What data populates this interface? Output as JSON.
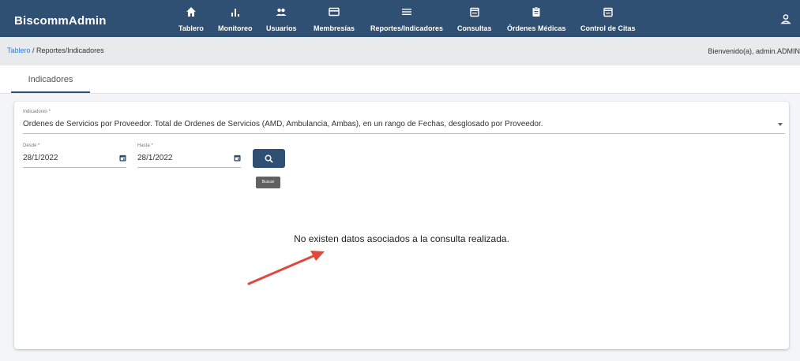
{
  "app": {
    "brand": "BiscommAdmin"
  },
  "nav": {
    "items": [
      {
        "label": "Tablero",
        "icon": "home-icon"
      },
      {
        "label": "Monitoreo",
        "icon": "bar-chart-icon"
      },
      {
        "label": "Usuarios",
        "icon": "users-icon"
      },
      {
        "label": "Membresías",
        "icon": "card-icon"
      },
      {
        "label": "Reportes/Indicadores",
        "icon": "list-icon"
      },
      {
        "label": "Consultas",
        "icon": "calendar-icon"
      },
      {
        "label": "Órdenes Médicas",
        "icon": "clipboard-icon"
      },
      {
        "label": "Control de Citas",
        "icon": "calendar-icon"
      }
    ],
    "user_icon": "user-icon"
  },
  "breadcrumb": {
    "root": "Tablero",
    "separator": " / ",
    "current": "Reportes/Indicadores"
  },
  "welcome": "Bienvenido(a), admin.ADMIN",
  "tabs": [
    {
      "label": "Indicadores",
      "active": true
    }
  ],
  "form": {
    "indicator": {
      "label": "Indicadores *",
      "value": "Órdenes de Servicios por Proveedor. Total de Órdenes de Servicios (AMD, Ambulancia, Ambas), en un rango de Fechas, desglosado por Proveedor."
    },
    "desde": {
      "label": "Desde *",
      "value": "28/1/2022"
    },
    "hasta": {
      "label": "Hasta *",
      "value": "28/1/2022"
    },
    "search_tooltip": "Buscar"
  },
  "message": "No existen datos asociados a la consulta realizada.",
  "colors": {
    "navbar": "#2f4f73",
    "arrow": "#e0483c",
    "link": "#2f7fd6"
  }
}
